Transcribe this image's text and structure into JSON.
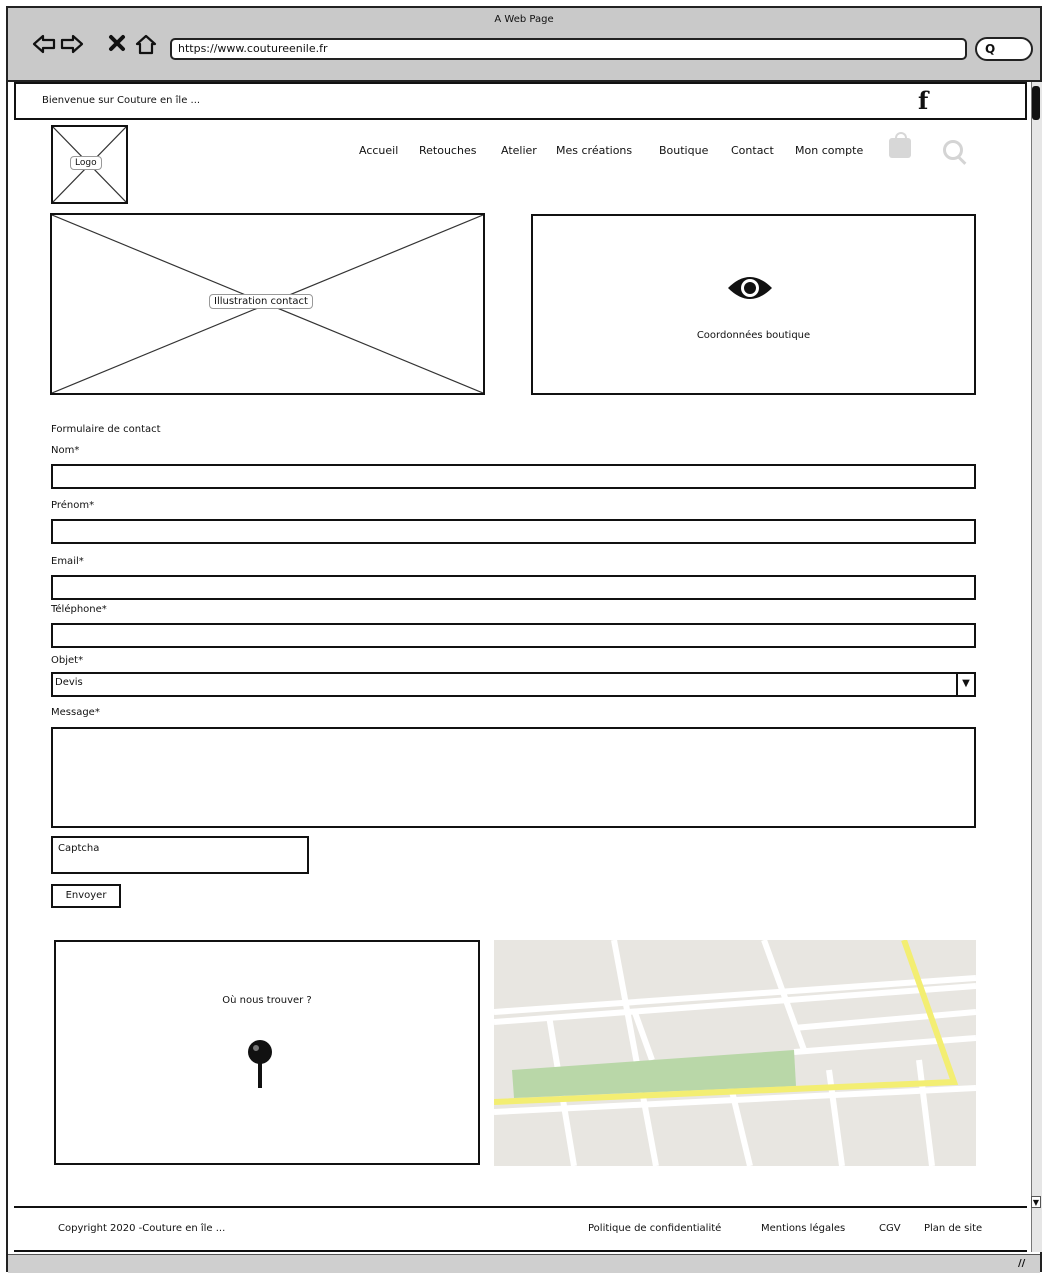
{
  "browser": {
    "window_title": "A Web Page",
    "url": "https://www.coutureenile.fr",
    "search_label": "Q"
  },
  "topbar": {
    "welcome": "Bienvenue sur Couture en île ...",
    "facebook_icon": "f"
  },
  "header": {
    "logo_label": "Logo",
    "nav": [
      "Accueil",
      "Retouches",
      "Atelier",
      "Mes créations",
      "Boutique",
      "Contact",
      "Mon compte"
    ]
  },
  "hero": {
    "illustration_label": "Illustration contact",
    "coordinates_label": "Coordonnées boutique"
  },
  "form": {
    "title": "Formulaire de contact",
    "nom_label": "Nom*",
    "prenom_label": "Prénom*",
    "email_label": "Email*",
    "telephone_label": "Téléphone*",
    "objet_label": "Objet*",
    "objet_value": "Devis",
    "message_label": "Message*",
    "captcha_label": "Captcha",
    "submit_label": "Envoyer"
  },
  "find_us": {
    "title": "Où nous trouver ?"
  },
  "footer": {
    "copyright": "Copyright 2020 -Couture en île ...",
    "links": [
      "Politique de confidentialité",
      "Mentions légales",
      "CGV",
      "Plan de site"
    ]
  }
}
